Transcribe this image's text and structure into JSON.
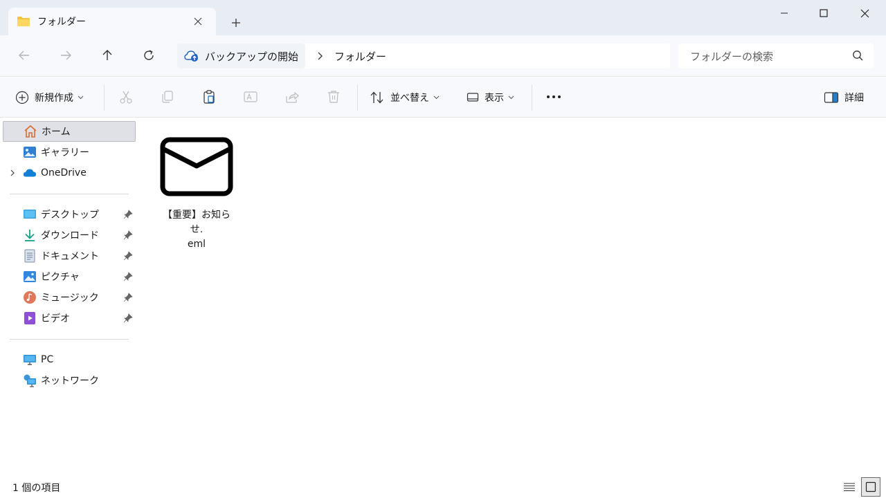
{
  "window": {
    "tab_title": "フォルダー",
    "minimize_icon": "minimize-icon",
    "maximize_icon": "maximize-icon",
    "close_icon": "close-icon"
  },
  "address": {
    "root_label": "バックアップの開始",
    "crumbs": [
      "フォルダー"
    ],
    "search_placeholder": "フォルダーの検索"
  },
  "toolbar": {
    "new_label": "新規作成",
    "sort_label": "並べ替え",
    "view_label": "表示",
    "details_label": "詳細"
  },
  "sidebar": {
    "items": [
      {
        "label": "ホーム",
        "icon": "home-icon"
      },
      {
        "label": "ギャラリー",
        "icon": "gallery-icon"
      },
      {
        "label": "OneDrive",
        "icon": "cloud-icon"
      },
      {
        "label": "デスクトップ",
        "icon": "desktop-icon"
      },
      {
        "label": "ダウンロード",
        "icon": "download-icon"
      },
      {
        "label": "ドキュメント",
        "icon": "document-icon"
      },
      {
        "label": "ピクチャ",
        "icon": "pictures-icon"
      },
      {
        "label": "ミュージック",
        "icon": "music-icon"
      },
      {
        "label": "ビデオ",
        "icon": "video-icon"
      },
      {
        "label": "PC",
        "icon": "pc-icon"
      },
      {
        "label": "ネットワーク",
        "icon": "network-icon"
      }
    ]
  },
  "content": {
    "files": [
      {
        "name_line1": "【重要】お知らせ.",
        "name_line2": "eml",
        "icon": "mail-icon"
      }
    ]
  },
  "status": {
    "item_count": "1 個の項目"
  },
  "colors": {
    "titlebar_bg": "#e8ecf3",
    "toolbar_bg": "#f7f9fc",
    "selected_bg": "#dfe1e6",
    "accent_blue": "#0067c0"
  }
}
